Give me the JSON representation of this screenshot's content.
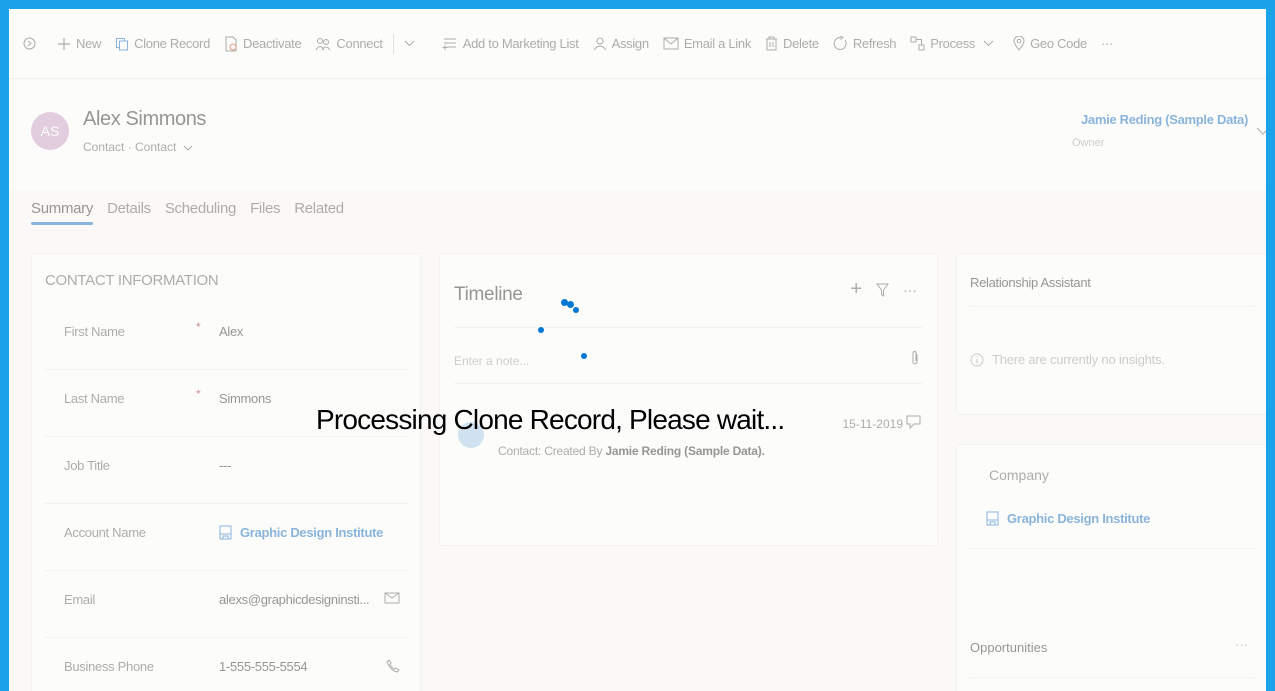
{
  "colors": {
    "frame": "#1aa3e8",
    "accent": "#1a6ec0",
    "spinner": "#0078d4",
    "avatar": "#c9a0c5"
  },
  "toolbar": {
    "items": [
      {
        "label": "New",
        "icon": "plus-icon"
      },
      {
        "label": "Clone Record",
        "icon": "copy-icon"
      },
      {
        "label": "Deactivate",
        "icon": "document-icon"
      },
      {
        "label": "Connect",
        "icon": "people-icon"
      },
      {
        "label": "Add to Marketing List",
        "icon": "list-add-icon"
      },
      {
        "label": "Assign",
        "icon": "person-icon"
      },
      {
        "label": "Email a Link",
        "icon": "email-icon"
      },
      {
        "label": "Delete",
        "icon": "trash-icon"
      },
      {
        "label": "Refresh",
        "icon": "refresh-icon"
      },
      {
        "label": "Process",
        "icon": "process-icon"
      },
      {
        "label": "Geo Code",
        "icon": "location-icon"
      }
    ],
    "more": "···"
  },
  "record": {
    "initials": "AS",
    "name": "Alex Simmons",
    "subtitle": "Contact · Contact",
    "owner_name": "Jamie Reding (Sample Data)",
    "owner_label": "Owner"
  },
  "tabs": [
    "Summary",
    "Details",
    "Scheduling",
    "Files",
    "Related"
  ],
  "contact_info": {
    "title": "CONTACT INFORMATION",
    "fields": [
      {
        "label": "First Name",
        "required": "*",
        "value": "Alex"
      },
      {
        "label": "Last Name",
        "required": "*",
        "value": "Simmons"
      },
      {
        "label": "Job Title",
        "value": "---"
      },
      {
        "label": "Account Name",
        "value": "Graphic Design Institute"
      },
      {
        "label": "Email",
        "value": "alexs@graphicdesigninsti..."
      },
      {
        "label": "Business Phone",
        "value": "1-555-555-5554"
      }
    ]
  },
  "timeline": {
    "title": "Timeline",
    "add": "+",
    "more": "···",
    "note_placeholder": "Enter a note...",
    "entry_date": "15-11-2019",
    "entry_desc_prefix": "Contact: Created By ",
    "entry_desc_bold": "Jamie Reding (Sample Data)."
  },
  "relationship": {
    "title": "Relationship Assistant",
    "message": "There are currently no insights."
  },
  "company": {
    "label": "Company",
    "value": "Graphic Design Institute"
  },
  "opportunities": {
    "title": "Opportunities",
    "more": "···"
  },
  "overlay": {
    "message": "Processing Clone Record, Please wait..."
  }
}
